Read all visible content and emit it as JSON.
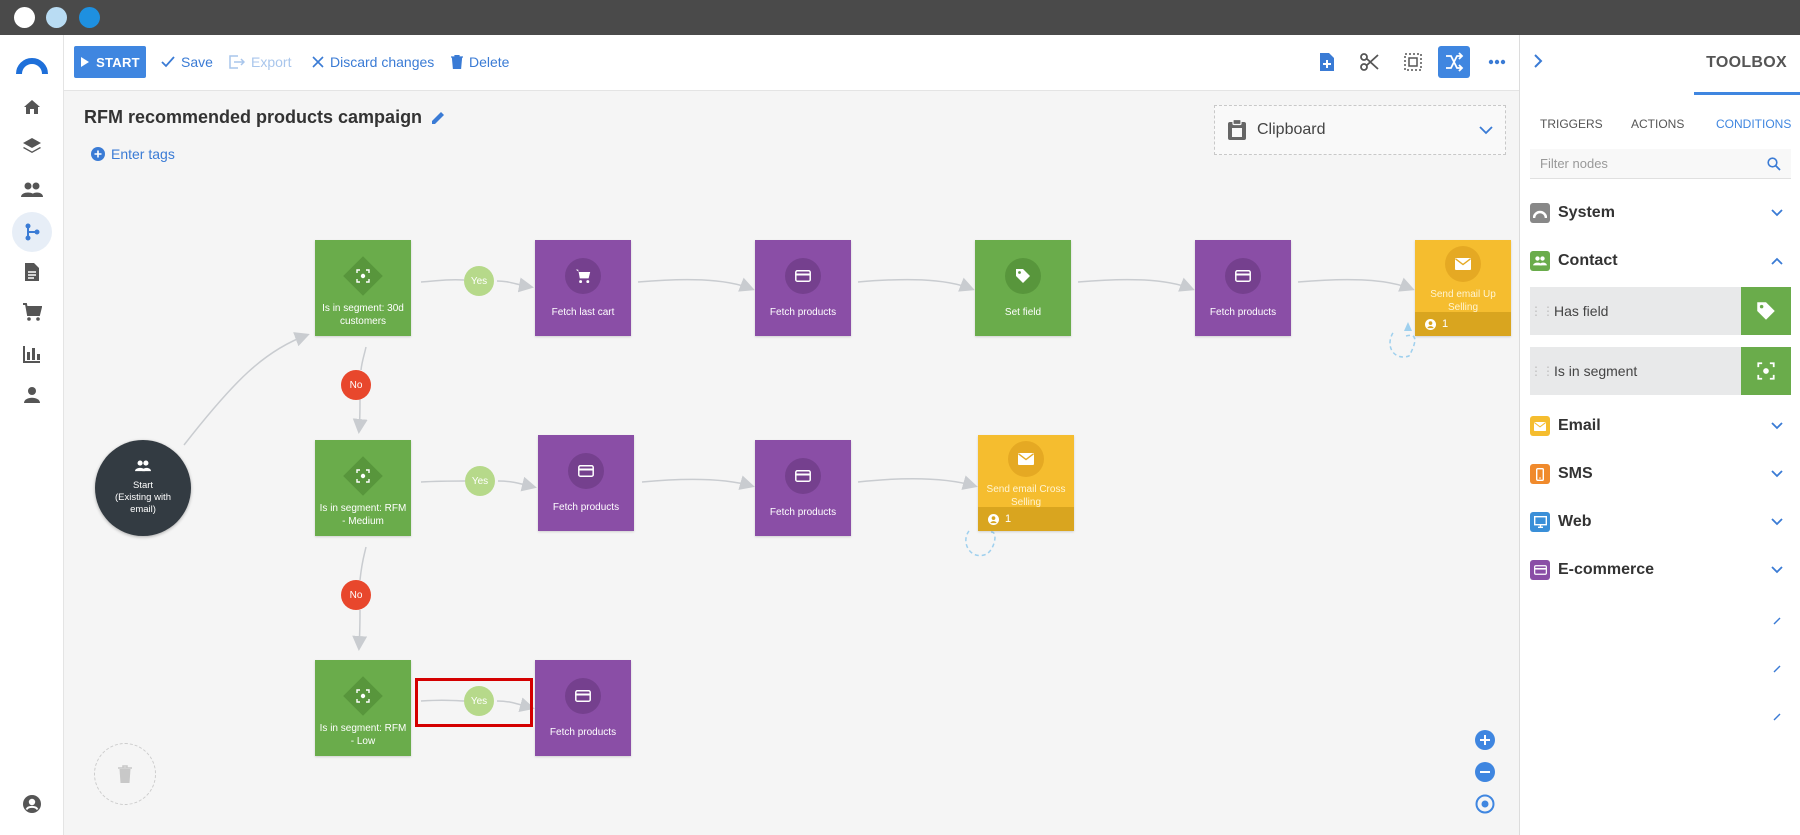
{
  "toolbar": {
    "start_label": "START",
    "save_label": "Save",
    "export_label": "Export",
    "discard_label": "Discard changes",
    "delete_label": "Delete"
  },
  "canvas": {
    "title": "RFM recommended products campaign",
    "enter_tags": "Enter tags",
    "clipboard_label": "Clipboard"
  },
  "nodes": {
    "start": {
      "line1": "Start",
      "line2": "(Existing with",
      "line3": "email)"
    },
    "seg_30d": "Is in segment: 30d customers",
    "fetch_last_cart": "Fetch last cart",
    "fetch_products_1": "Fetch products",
    "set_field": "Set field",
    "fetch_products_2": "Fetch products",
    "send_upselling": "Send email Up Selling",
    "send_upselling_count": "1",
    "seg_medium": "Is in segment: RFM - Medium",
    "fetch_products_3": "Fetch products",
    "fetch_products_4": "Fetch products",
    "send_cross": "Send email Cross Selling",
    "send_cross_count": "1",
    "seg_low": "Is in segment: RFM - Low",
    "fetch_products_5": "Fetch products"
  },
  "badges": {
    "yes": "Yes",
    "no": "No"
  },
  "toolbox": {
    "title": "TOOLBOX",
    "tabs": [
      "TRIGGERS",
      "ACTIONS",
      "CONDITIONS"
    ],
    "filter_placeholder": "Filter nodes",
    "categories": [
      "System",
      "Contact",
      "Email",
      "SMS",
      "Web",
      "E-commerce"
    ],
    "contact_items": [
      "Has field",
      "Is in segment"
    ]
  },
  "colors": {
    "accent": "#3f86e0",
    "condition_green": "#6aac4b",
    "action_purple": "#8a4ea6",
    "email_yellow": "#f5bd2f",
    "no_red": "#e8472c",
    "yes_green": "#b6d98a",
    "highlight_red": "#d40000"
  }
}
